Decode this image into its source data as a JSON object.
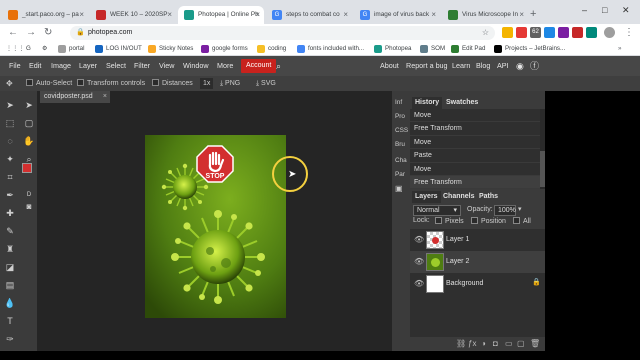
{
  "browser": {
    "tabs": [
      {
        "label": "_start.paco.org – pa",
        "icon": "paco-icon",
        "color": "#e8710a",
        "active": false
      },
      {
        "label": "WEEK 10 – 2020SP",
        "icon": "canvas-icon",
        "color": "#c62828",
        "active": false
      },
      {
        "label": "Photopea | Online Ph",
        "icon": "photopea-icon",
        "color": "#1a9b8a",
        "active": true
      },
      {
        "label": "steps to combat co",
        "icon": "google-icon",
        "color": "#4285f4",
        "active": false
      },
      {
        "label": "image of virus back",
        "icon": "google-icon",
        "color": "#4285f4",
        "active": false
      },
      {
        "label": "Virus Microscope In",
        "icon": "image-icon",
        "color": "#2e7d32",
        "active": false
      }
    ],
    "new_tab": "+",
    "window_controls": [
      "–",
      "□",
      "✕"
    ],
    "url": "photopea.com",
    "extensions": [
      "62"
    ],
    "bookmarks": [
      {
        "label": "portal",
        "color": "#9e9e9e"
      },
      {
        "label": "LOG IN/OUT",
        "color": "#1565c0"
      },
      {
        "label": "Sticky Notes",
        "color": "#f9a825"
      },
      {
        "label": "google forms",
        "color": "#7b1fa2"
      },
      {
        "label": "coding",
        "color": "#f6bf26"
      },
      {
        "label": "fonts included with...",
        "color": "#4285f4"
      },
      {
        "label": "Photopea",
        "color": "#1a9b8a"
      },
      {
        "label": "SOM",
        "color": "#607d8b"
      },
      {
        "label": "Edit Pad",
        "color": "#2e7d32"
      },
      {
        "label": "Projects – JetBrains...",
        "color": "#000000"
      }
    ]
  },
  "photopea": {
    "menu": [
      "File",
      "Edit",
      "Image",
      "Layer",
      "Select",
      "Filter",
      "View",
      "Window",
      "More"
    ],
    "account": "Account",
    "right_menu": [
      "About",
      "Report a bug",
      "Learn",
      "Blog",
      "API"
    ],
    "options": {
      "auto_select": "Auto-Select",
      "transform_controls": "Transform controls",
      "distances": "Distances",
      "zoom": "1x",
      "export_png": "PNG",
      "export_svg": "SVG"
    },
    "document_tab": "covidposter.psd",
    "side_panel_tabs": [
      "Inf",
      "Pro",
      "CSS",
      "Bru",
      "Cha",
      "Par"
    ],
    "history": {
      "tabs": [
        "History",
        "Swatches"
      ],
      "items": [
        "Move",
        "Free Transform",
        "Move",
        "Paste",
        "Move",
        "Free Transform"
      ]
    },
    "layers": {
      "tabs": [
        "Layers",
        "Channels",
        "Paths"
      ],
      "blend_mode": "Normal",
      "opacity_label": "Opacity:",
      "opacity_value": "100%",
      "lock_label": "Lock:",
      "lock_options": [
        "Pixels",
        "Position",
        "All"
      ],
      "items": [
        {
          "name": "Layer 1"
        },
        {
          "name": "Layer 2"
        },
        {
          "name": "Background"
        }
      ]
    },
    "poster": {
      "stop_text": "STOP",
      "background": "#5f8f16",
      "accent_red": "#d32f2f"
    }
  },
  "colors": {
    "account_red": "#c8221d",
    "panel_dark": "#3b3b3b",
    "canvas_bg": "#252525"
  }
}
